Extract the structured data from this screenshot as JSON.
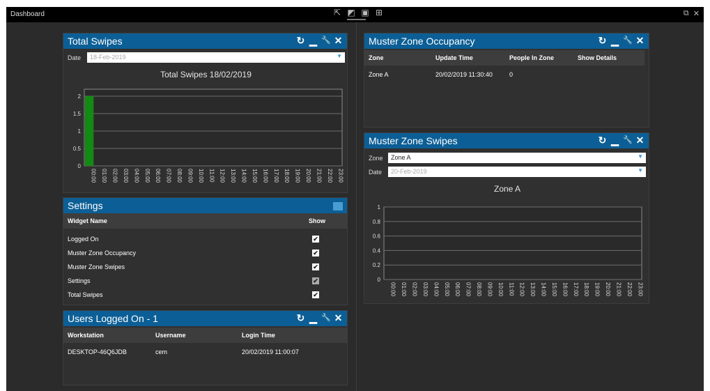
{
  "topbar": {
    "title": "Dashboard",
    "icons": [
      "export-icon",
      "chat-icon",
      "frame-icon",
      "layout-icon"
    ],
    "restore_glyph": "⧉",
    "close_glyph": "✕"
  },
  "controls": {
    "refresh": "↻",
    "minimize": "▁",
    "settings": "🔧",
    "close": "✕"
  },
  "total_swipes": {
    "title": "Total Swipes",
    "date_label": "Date",
    "date_value": "18-Feb-2019",
    "chart_title": "Total Swipes 18/02/2019"
  },
  "settings": {
    "title": "Settings",
    "col_widget": "Widget Name",
    "col_show": "Show",
    "rows": [
      {
        "name": "Logged On",
        "checked": true
      },
      {
        "name": "Muster Zone Occupancy",
        "checked": true
      },
      {
        "name": "Muster Zone Swipes",
        "checked": true
      },
      {
        "name": "Settings",
        "checked": true,
        "disabled": true
      },
      {
        "name": "Total Swipes",
        "checked": true
      }
    ]
  },
  "users_logged_on": {
    "title": "Users Logged On - 1",
    "columns": [
      "Workstation",
      "Username",
      "Login Time"
    ],
    "rows": [
      {
        "workstation": "DESKTOP-46Q6JDB",
        "username": "cem",
        "login_time": "20/02/2019 11:00:07"
      }
    ]
  },
  "muster_occupancy": {
    "title": "Muster Zone Occupancy",
    "columns": [
      "Zone",
      "Update Time",
      "People In Zone",
      "Show Details"
    ],
    "rows": [
      {
        "zone": "Zone A",
        "update_time": "20/02/2019 11:30:40",
        "people": "0"
      }
    ]
  },
  "muster_swipes": {
    "title": "Muster Zone Swipes",
    "zone_label": "Zone",
    "zone_value": "Zone A",
    "date_label": "Date",
    "date_value": "20-Feb-2019",
    "chart_title": "Zone A"
  },
  "chart_data": [
    {
      "type": "bar",
      "title": "Total Swipes 18/02/2019",
      "categories": [
        "00:00",
        "01:00",
        "02:00",
        "03:00",
        "04:00",
        "05:00",
        "06:00",
        "07:00",
        "08:00",
        "09:00",
        "10:00",
        "11:00",
        "12:00",
        "13:00",
        "14:00",
        "15:00",
        "16:00",
        "17:00",
        "18:00",
        "19:00",
        "20:00",
        "21:00",
        "22:00",
        "23:00"
      ],
      "values": [
        2,
        0,
        0,
        0,
        0,
        0,
        0,
        0,
        0,
        0,
        0,
        0,
        0,
        0,
        0,
        0,
        0,
        0,
        0,
        0,
        0,
        0,
        0,
        0
      ],
      "yticks": [
        "0",
        "0.5",
        "1",
        "1.5",
        "2"
      ],
      "ylim": [
        0,
        2.2
      ],
      "color": "#138a13",
      "grid": true
    },
    {
      "type": "bar",
      "title": "Zone A",
      "categories": [
        "00:00",
        "01:00",
        "02:00",
        "03:00",
        "04:00",
        "05:00",
        "06:00",
        "07:00",
        "08:00",
        "09:00",
        "10:00",
        "11:00",
        "12:00",
        "13:00",
        "14:00",
        "15:00",
        "16:00",
        "17:00",
        "18:00",
        "19:00",
        "20:00",
        "21:00",
        "22:00",
        "23:00"
      ],
      "values": [
        0,
        0,
        0,
        0,
        0,
        0,
        0,
        0,
        0,
        0,
        0,
        0,
        0,
        0,
        0,
        0,
        0,
        0,
        0,
        0,
        0,
        0,
        0,
        0
      ],
      "yticks": [
        "0",
        "0.2",
        "0.4",
        "0.6",
        "0.8",
        "1"
      ],
      "ylim": [
        0,
        1
      ],
      "color": "#138a13",
      "grid": true
    }
  ]
}
